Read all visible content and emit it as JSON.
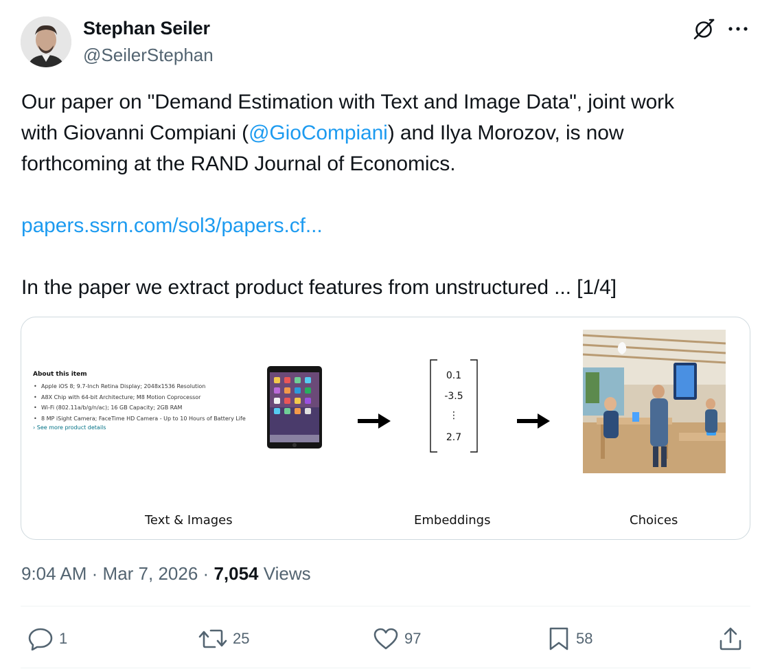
{
  "author": {
    "display_name": "Stephan Seiler",
    "handle": "@SeilerStephan"
  },
  "header_icons": [
    "grok-icon",
    "more-icon"
  ],
  "tweet": {
    "line1": "Our paper on \"Demand Estimation with Text and Image Data\", joint work",
    "line2_before": "with Giovanni Compiani (",
    "mention": "@GioCompiani",
    "line2_after": ") and Ilya Morozov, is now",
    "line3": "forthcoming at the RAND Journal of Economics.",
    "link": "papers.ssrn.com/sol3/papers.cf...",
    "line5": "In the paper we extract product features from unstructured ... [1/4]"
  },
  "media": {
    "about_title": "About this item",
    "about_items": [
      "Apple iOS 8; 9.7-Inch Retina Display; 2048x1536 Resolution",
      "A8X Chip with 64-bit Architecture; M8 Motion Coprocessor",
      "Wi-Fi (802.11a/b/g/n/ac); 16 GB Capacity; 2GB RAM",
      "8 MP iSight Camera; FaceTime HD Camera - Up to 10 Hours of Battery Life"
    ],
    "about_more": "› See more product details",
    "embedding_values": [
      "0.1",
      "-3.5",
      "⋮",
      "2.7"
    ],
    "captions": {
      "text_images": "Text & Images",
      "embeddings": "Embeddings",
      "choices": "Choices"
    }
  },
  "meta": {
    "time": "9:04 AM",
    "separator": "·",
    "date": "Mar 7, 2026",
    "views_count": "7,054",
    "views_label": "Views"
  },
  "actions": {
    "replies": "1",
    "reposts": "25",
    "likes": "97",
    "bookmarks": "58"
  },
  "colors": {
    "link": "#1d9bf0",
    "secondary_text": "#536471",
    "primary_text": "#0f1419",
    "border": "#cfd9de"
  }
}
